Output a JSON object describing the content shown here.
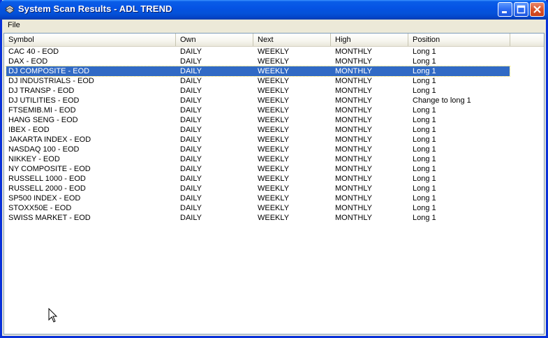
{
  "window": {
    "title": "System Scan Results - ADL TREND"
  },
  "menu": {
    "file_label": "File"
  },
  "table": {
    "columns": [
      "Symbol",
      "Own",
      "Next",
      "High",
      "Position"
    ],
    "selected_index": 2,
    "rows": [
      [
        "CAC 40 - EOD",
        "DAILY",
        "WEEKLY",
        "MONTHLY",
        "Long 1"
      ],
      [
        "DAX - EOD",
        "DAILY",
        "WEEKLY",
        "MONTHLY",
        "Long 1"
      ],
      [
        "DJ COMPOSITE - EOD",
        "DAILY",
        "WEEKLY",
        "MONTHLY",
        "Long 1"
      ],
      [
        "DJ INDUSTRIALS - EOD",
        "DAILY",
        "WEEKLY",
        "MONTHLY",
        "Long 1"
      ],
      [
        "DJ TRANSP - EOD",
        "DAILY",
        "WEEKLY",
        "MONTHLY",
        "Long 1"
      ],
      [
        "DJ UTILITIES - EOD",
        "DAILY",
        "WEEKLY",
        "MONTHLY",
        "Change to long 1"
      ],
      [
        "FTSEMIB.MI - EOD",
        "DAILY",
        "WEEKLY",
        "MONTHLY",
        "Long 1"
      ],
      [
        "HANG SENG - EOD",
        "DAILY",
        "WEEKLY",
        "MONTHLY",
        "Long 1"
      ],
      [
        "IBEX - EOD",
        "DAILY",
        "WEEKLY",
        "MONTHLY",
        "Long 1"
      ],
      [
        "JAKARTA INDEX - EOD",
        "DAILY",
        "WEEKLY",
        "MONTHLY",
        "Long 1"
      ],
      [
        "NASDAQ 100 - EOD",
        "DAILY",
        "WEEKLY",
        "MONTHLY",
        "Long 1"
      ],
      [
        "NIKKEY - EOD",
        "DAILY",
        "WEEKLY",
        "MONTHLY",
        "Long 1"
      ],
      [
        "NY COMPOSITE - EOD",
        "DAILY",
        "WEEKLY",
        "MONTHLY",
        "Long 1"
      ],
      [
        "RUSSELL 1000 - EOD",
        "DAILY",
        "WEEKLY",
        "MONTHLY",
        "Long 1"
      ],
      [
        "RUSSELL 2000 - EOD",
        "DAILY",
        "WEEKLY",
        "MONTHLY",
        "Long 1"
      ],
      [
        "SP500 INDEX - EOD",
        "DAILY",
        "WEEKLY",
        "MONTHLY",
        "Long 1"
      ],
      [
        "STOXX50E - EOD",
        "DAILY",
        "WEEKLY",
        "MONTHLY",
        "Long 1"
      ],
      [
        "SWISS MARKET - EOD",
        "DAILY",
        "WEEKLY",
        "MONTHLY",
        "Long 1"
      ]
    ]
  },
  "colors": {
    "titlebar": "#0553e4",
    "selection": "#316ac5",
    "close_button": "#d9542c"
  },
  "icons": {
    "app": "app-icon",
    "minimize": "minimize-icon",
    "maximize": "maximize-icon",
    "close": "close-icon",
    "cursor": "mouse-pointer-icon"
  }
}
